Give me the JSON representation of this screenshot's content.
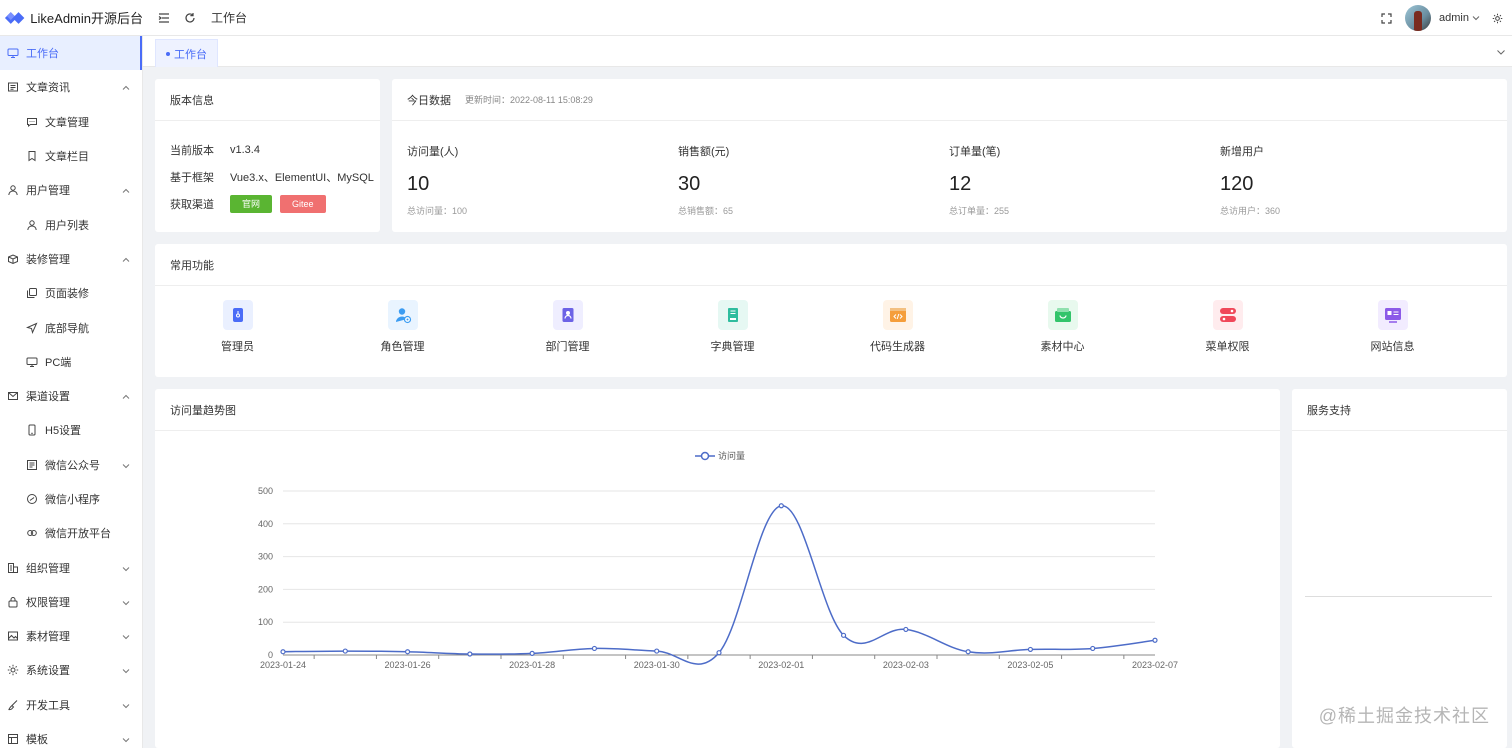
{
  "app": {
    "name": "LikeAdmin开源后台"
  },
  "header": {
    "breadcrumb": "工作台",
    "user": "admin"
  },
  "tabs": [
    {
      "label": "工作台"
    }
  ],
  "sidebar": {
    "items": [
      {
        "label": "工作台",
        "icon": "monitor-icon",
        "level": 1,
        "active": true
      },
      {
        "label": "文章资讯",
        "icon": "article-icon",
        "level": 1,
        "arrow": "up"
      },
      {
        "label": "文章管理",
        "icon": "message-icon",
        "level": 2
      },
      {
        "label": "文章栏目",
        "icon": "bookmark-icon",
        "level": 2
      },
      {
        "label": "用户管理",
        "icon": "user-icon",
        "level": 1,
        "arrow": "up"
      },
      {
        "label": "用户列表",
        "icon": "user-icon",
        "level": 2
      },
      {
        "label": "装修管理",
        "icon": "box-icon",
        "level": 1,
        "arrow": "up"
      },
      {
        "label": "页面装修",
        "icon": "copy-icon",
        "level": 2
      },
      {
        "label": "底部导航",
        "icon": "send-icon",
        "level": 2
      },
      {
        "label": "PC端",
        "icon": "monitor-icon",
        "level": 2
      },
      {
        "label": "渠道设置",
        "icon": "mail-icon",
        "level": 1,
        "arrow": "up"
      },
      {
        "label": "H5设置",
        "icon": "phone-icon",
        "level": 2
      },
      {
        "label": "微信公众号",
        "icon": "wechat-icon",
        "level": 2,
        "arrow": "down"
      },
      {
        "label": "微信小程序",
        "icon": "miniapp-icon",
        "level": 2
      },
      {
        "label": "微信开放平台",
        "icon": "link-icon",
        "level": 2
      },
      {
        "label": "组织管理",
        "icon": "org-icon",
        "level": 1,
        "arrow": "down"
      },
      {
        "label": "权限管理",
        "icon": "lock-icon",
        "level": 1,
        "arrow": "down"
      },
      {
        "label": "素材管理",
        "icon": "picture-icon",
        "level": 1,
        "arrow": "down"
      },
      {
        "label": "系统设置",
        "icon": "gear-icon",
        "level": 1,
        "arrow": "down"
      },
      {
        "label": "开发工具",
        "icon": "brush-icon",
        "level": 1,
        "arrow": "down"
      },
      {
        "label": "模板",
        "icon": "template-icon",
        "level": 1,
        "arrow": "down"
      }
    ]
  },
  "version": {
    "title": "版本信息",
    "rows": [
      {
        "k": "当前版本",
        "v": "v1.3.4"
      },
      {
        "k": "基于框架",
        "v": "Vue3.x、ElementUI、MySQL"
      }
    ],
    "channel_label": "获取渠道",
    "buttons": [
      {
        "label": "官网",
        "color": "#5ab532"
      },
      {
        "label": "Gitee",
        "color": "#f07070"
      }
    ]
  },
  "today": {
    "title": "今日数据",
    "update": "更新时间：2022-08-11 15:08:29",
    "stats": [
      {
        "label": "访问量(人)",
        "value": "10",
        "total": "总访问量：100"
      },
      {
        "label": "销售额(元)",
        "value": "30",
        "total": "总销售额：65"
      },
      {
        "label": "订单量(笔)",
        "value": "12",
        "total": "总订单量：255"
      },
      {
        "label": "新增用户",
        "value": "120",
        "total": "总访用户：360"
      }
    ]
  },
  "functions": {
    "title": "常用功能",
    "items": [
      {
        "label": "管理员",
        "icon": "admin-icon",
        "color": "#4a6cf7",
        "bg": "#eaf0ff"
      },
      {
        "label": "角色管理",
        "icon": "role-icon",
        "color": "#3b9cf2",
        "bg": "#e9f4ff"
      },
      {
        "label": "部门管理",
        "icon": "dept-icon",
        "color": "#6c63e6",
        "bg": "#efeeff"
      },
      {
        "label": "字典管理",
        "icon": "dict-icon",
        "color": "#2ebd9e",
        "bg": "#e6f8f3"
      },
      {
        "label": "代码生成器",
        "icon": "code-icon",
        "color": "#f59e3b",
        "bg": "#fff3e6"
      },
      {
        "label": "素材中心",
        "icon": "material-icon",
        "color": "#33c46b",
        "bg": "#e8f9ee"
      },
      {
        "label": "菜单权限",
        "icon": "menu-perm-icon",
        "color": "#f0485a",
        "bg": "#ffecee"
      },
      {
        "label": "网站信息",
        "icon": "site-icon",
        "color": "#8c5ae8",
        "bg": "#f2ecff"
      }
    ]
  },
  "trend": {
    "title": "访问量趋势图"
  },
  "service": {
    "title": "服务支持"
  },
  "watermark": "@稀土掘金技术社区",
  "chart_data": {
    "type": "line",
    "x": [
      "2023-01-24",
      "2023-01-25",
      "2023-01-26",
      "2023-01-27",
      "2023-01-28",
      "2023-01-29",
      "2023-01-30",
      "2023-01-31",
      "2023-02-01",
      "2023-02-02",
      "2023-02-03",
      "2023-02-04",
      "2023-02-05",
      "2023-02-06",
      "2023-02-07"
    ],
    "x_tick_labels": [
      "2023-01-24",
      "2023-01-26",
      "2023-01-28",
      "2023-01-30",
      "2023-02-01",
      "2023-02-03",
      "2023-02-05",
      "2023-02-07"
    ],
    "series": [
      {
        "name": "访问量",
        "values": [
          10,
          12,
          10,
          3,
          5,
          20,
          12,
          7,
          455,
          60,
          78,
          10,
          17,
          20,
          45
        ],
        "color": "#4d6cc8"
      }
    ],
    "ylim": [
      0,
      500
    ],
    "y_ticks": [
      0,
      100,
      200,
      300,
      400,
      500
    ],
    "legend": "top-center",
    "grid": true
  }
}
